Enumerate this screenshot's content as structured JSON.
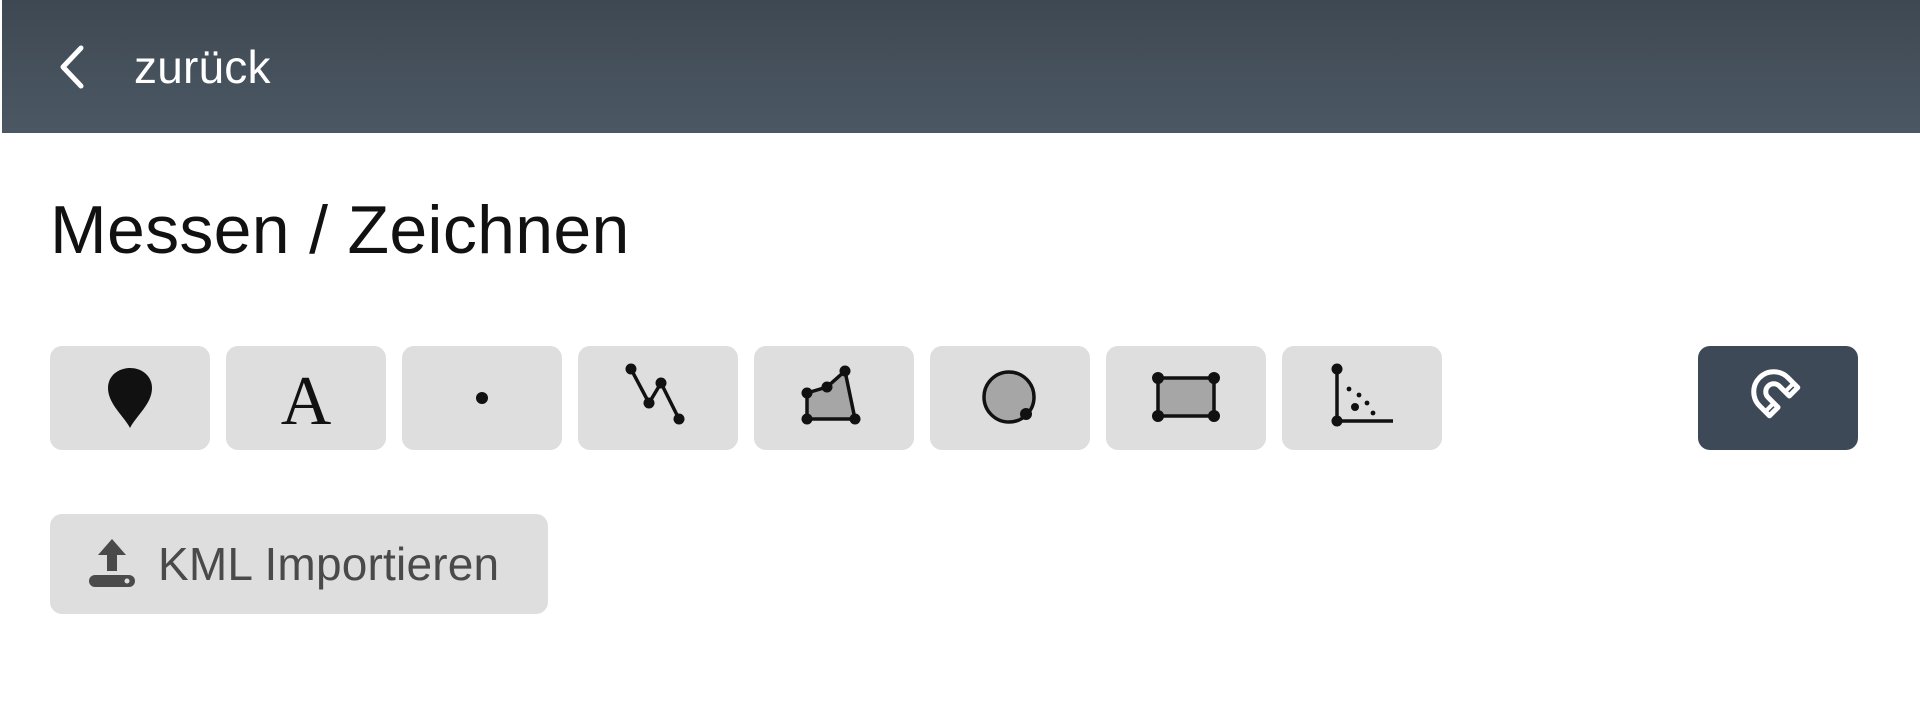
{
  "header": {
    "back_label": "zurück",
    "back_icon": "chevron-left-icon"
  },
  "page": {
    "title": "Messen / Zeichnen"
  },
  "tools": [
    {
      "name": "marker-tool",
      "icon": "map-pin-icon"
    },
    {
      "name": "text-tool",
      "icon": "text-a-icon",
      "glyph": "A"
    },
    {
      "name": "point-tool",
      "icon": "point-icon"
    },
    {
      "name": "line-tool",
      "icon": "polyline-icon"
    },
    {
      "name": "polygon-tool",
      "icon": "polygon-icon"
    },
    {
      "name": "circle-tool",
      "icon": "circle-icon"
    },
    {
      "name": "rectangle-tool",
      "icon": "rectangle-icon"
    },
    {
      "name": "angle-tool",
      "icon": "angle-measure-icon"
    }
  ],
  "snap": {
    "icon": "magnet-icon",
    "active": true
  },
  "import": {
    "label": "KML Importieren",
    "icon": "upload-icon"
  },
  "colors": {
    "header_top": "#3e4852",
    "header_bottom": "#4b5864",
    "tool_bg": "#dedede",
    "snap_bg": "#3e4957",
    "icon_dark": "#111111",
    "shape_fill": "#a6a6a6"
  }
}
